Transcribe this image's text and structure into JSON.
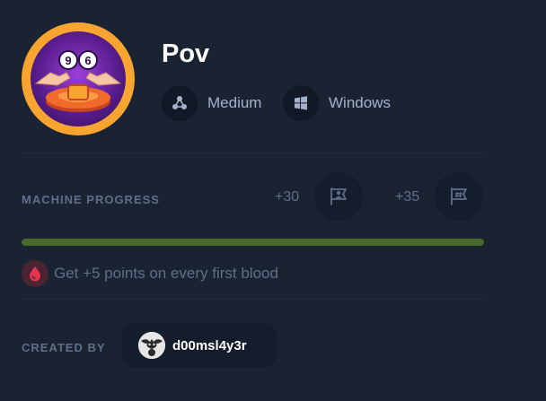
{
  "machine": {
    "name": "Pov",
    "difficulty": "Medium",
    "os": "Windows",
    "logo_numbers": [
      "9",
      "6"
    ]
  },
  "progress": {
    "label": "MACHINE PROGRESS",
    "user_points": "+30",
    "root_points": "+35",
    "fraction": 1.0,
    "bar_color": "#4a6b2c"
  },
  "first_blood": {
    "text": "Get +5 points on every first blood"
  },
  "creator": {
    "label": "CREATED BY",
    "username": "d00msl4y3r"
  },
  "icons": {
    "difficulty": "difficulty-nodes-icon",
    "os": "windows-icon",
    "user_flag": "user-flag-icon",
    "root_flag": "root-flag-icon",
    "first_blood": "blood-drop-icon"
  },
  "colors": {
    "accent_orange": "#f7a431",
    "background": "#1a2332",
    "blood": "#e5344d"
  }
}
